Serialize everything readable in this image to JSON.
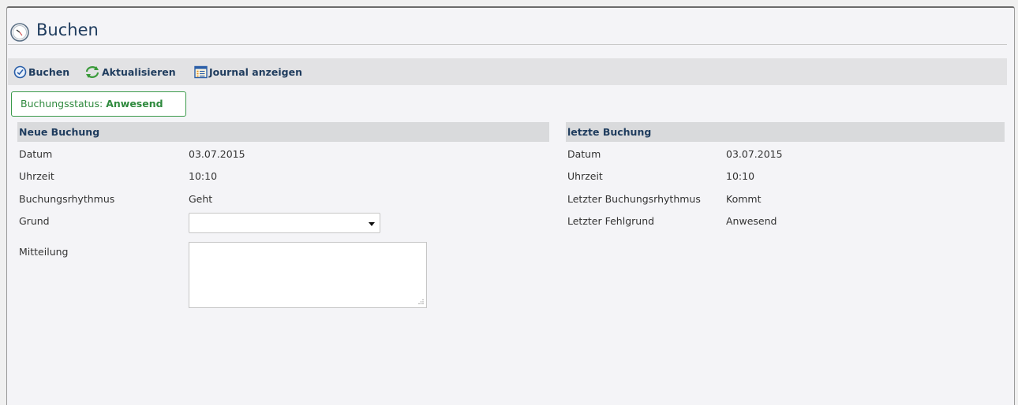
{
  "page": {
    "title": "Buchen"
  },
  "toolbar": {
    "items": [
      {
        "label": "Buchen",
        "icon": "clock-check-icon"
      },
      {
        "label": "Aktualisieren",
        "icon": "refresh-icon"
      },
      {
        "label": "Journal anzeigen",
        "icon": "journal-list-icon"
      }
    ]
  },
  "status": {
    "label": "Buchungsstatus:",
    "value": "Anwesend",
    "color": "#2f8a3e"
  },
  "neue_buchung": {
    "heading": "Neue Buchung",
    "datum_label": "Datum",
    "datum_value": "03.07.2015",
    "uhrzeit_label": "Uhrzeit",
    "uhrzeit_value": "10:10",
    "rhythmus_label": "Buchungsrhythmus",
    "rhythmus_value": "Geht",
    "grund_label": "Grund",
    "grund_value": "",
    "mitteilung_label": "Mitteilung",
    "mitteilung_value": ""
  },
  "letzte_buchung": {
    "heading": "letzte Buchung",
    "datum_label": "Datum",
    "datum_value": "03.07.2015",
    "uhrzeit_label": "Uhrzeit",
    "uhrzeit_value": "10:10",
    "rhythmus_label": "Letzter Buchungsrhythmus",
    "rhythmus_value": "Kommt",
    "fehlgrund_label": "Letzter Fehlgrund",
    "fehlgrund_value": "Anwesend"
  },
  "colors": {
    "accent": "#1f3c5e",
    "section_bg": "#d9dadc",
    "toolbar_bg": "#e2e2e4"
  }
}
